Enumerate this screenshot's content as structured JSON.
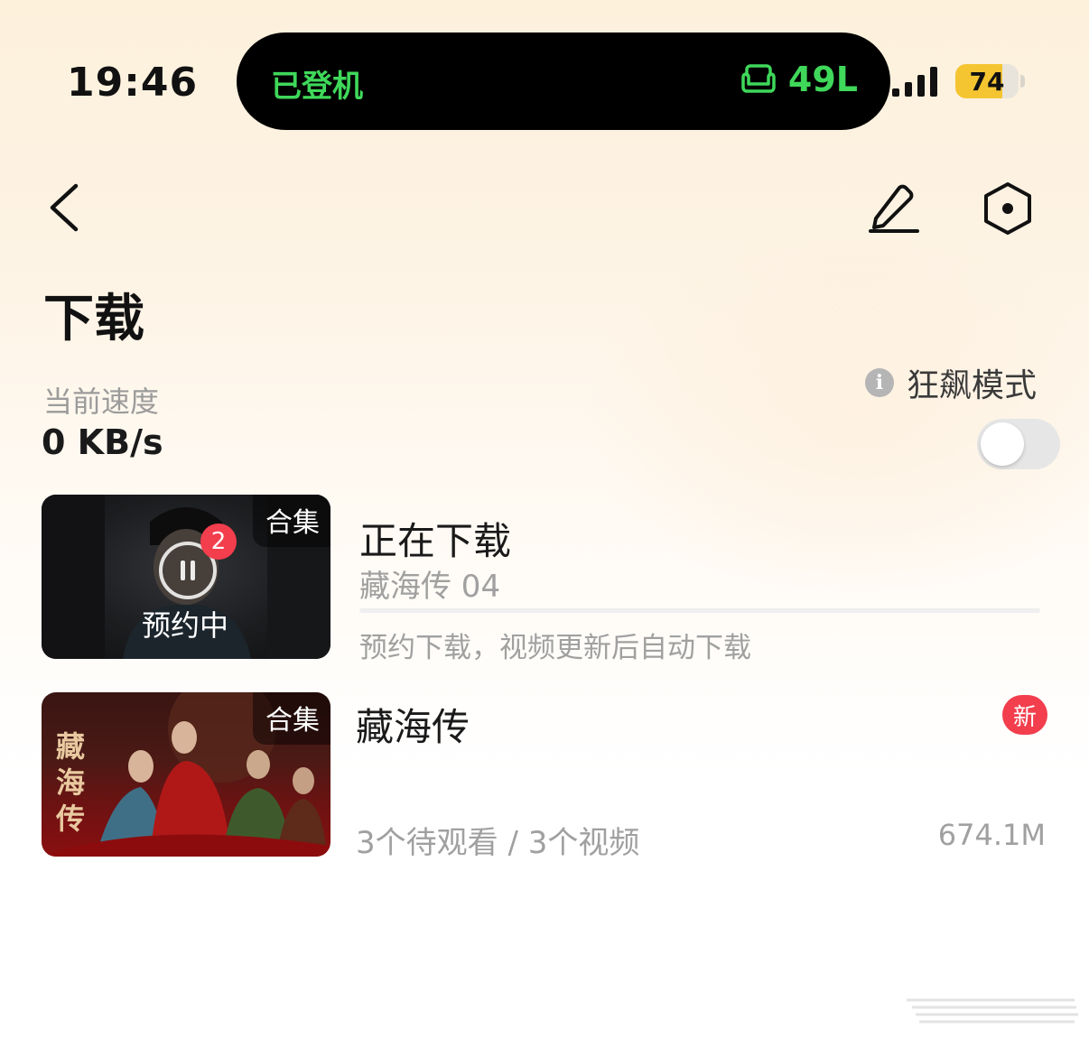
{
  "status_bar": {
    "time": "19:46",
    "island_left": "已登机",
    "island_right": "49L",
    "battery": "74",
    "battery_level": 0.74
  },
  "page": {
    "title": "下载",
    "speed_label": "当前速度",
    "speed_value": "0 KB/s",
    "mode_label": "狂飙模式",
    "mode_enabled": false
  },
  "downloading": {
    "tag": "合集",
    "count": "2",
    "status_overlay": "预约中",
    "title": "正在下载",
    "episode": "藏海传 04",
    "progress": 0,
    "note": "预约下载，视频更新后自动下载"
  },
  "collection": {
    "tag": "合集",
    "poster_title": "藏海传",
    "title": "藏海传",
    "new_badge": "新",
    "summary": "3个待观看 / 3个视频",
    "size": "674.1M"
  },
  "colors": {
    "accent_green": "#3fd85a",
    "badge_red": "#f23e4d",
    "battery_yellow": "#f4c531"
  }
}
